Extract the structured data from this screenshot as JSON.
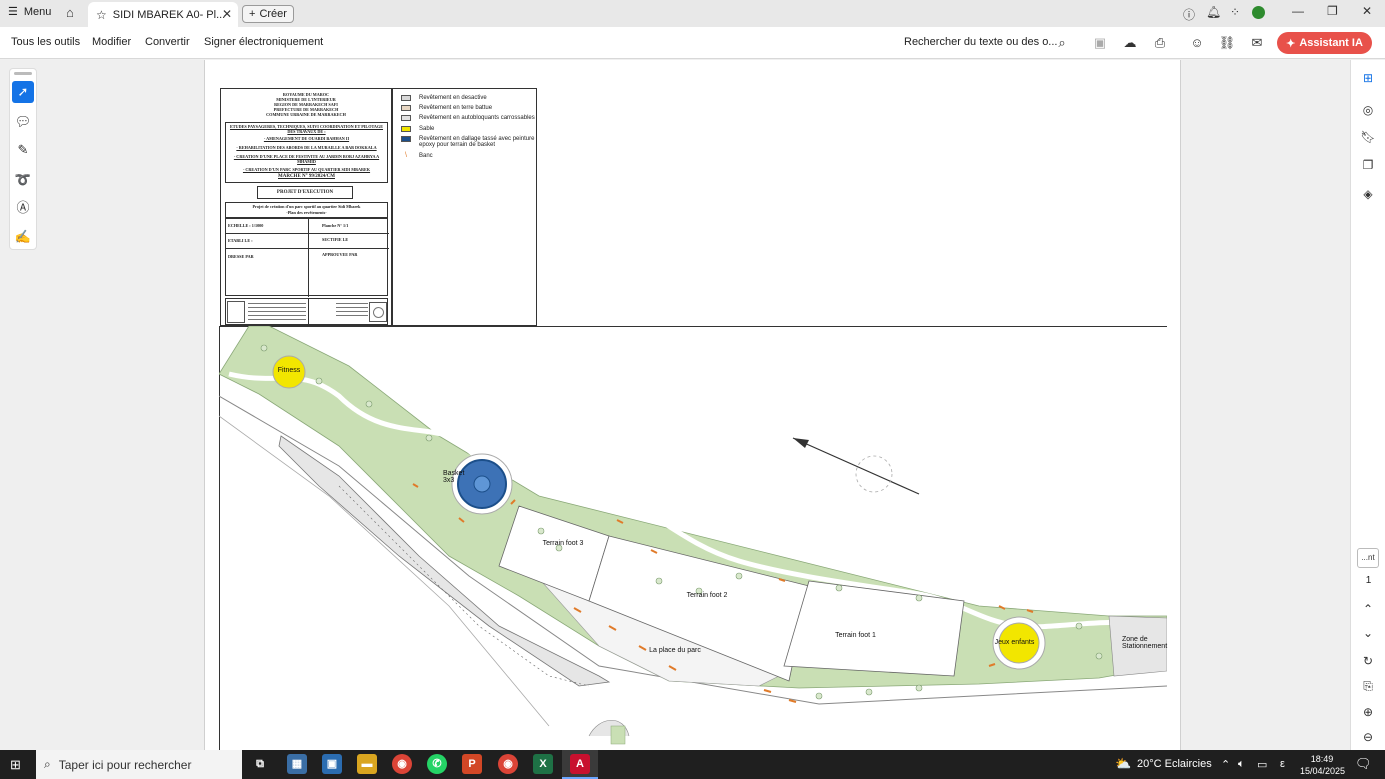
{
  "window": {
    "menu_label": "Menu",
    "tab_title": "SIDI MBAREK A0- Pl...",
    "tab_close": "✕",
    "create_label": "Créer",
    "controls": [
      "—",
      "❐",
      "✕"
    ]
  },
  "toolbar": {
    "all_tools": "Tous les outils",
    "edit": "Modifier",
    "convert": "Convertir",
    "sign": "Signer électroniquement",
    "search_text": "Rechercher du texte ou des o...",
    "assistant": "Assistant IA"
  },
  "rightrail": {
    "page_box": "...nt",
    "page_number": "1"
  },
  "plan": {
    "cartouche": {
      "header": [
        "ROYAUME DU MAROC",
        "MINISTERE DE L'INTERIEUR",
        "REGION DE MARRAKECH SAFI",
        "PREFECTURE DE MARRAKECH",
        "COMMUNE URBAINE DE MARRAKECH"
      ],
      "study_title": "ETUDES PAYSAGERES, TECHNIQUES, SUIVI COORDINATION ET PILOTAGE DES TRAVAUX DE :",
      "items": [
        "- AMENAGEMENT DE OUARDI BAHHAN II",
        "- REHABILITATION DES ABORDS DE LA MURAILLE A BAB DOKKALA",
        "- CREATION D'UNE PLACE DE FESTIVITE AU JARDIN BORJ AZAHRYA A MHAMID",
        "- CREATION D'UN PARC SPORTIF AU QUARTIER SIDI MBAREK"
      ],
      "marche": "MARCHE N° 99/2024/CM",
      "phase": "PROJET D'EXECUTION",
      "project_line1": "Projet de création d'un parc sportif au quartier Sidi Mbarek",
      "project_line2": "-Plan des revêtements-",
      "scale": "ECHELLE : 1/1000",
      "sheet": "Planche N° 1/1",
      "established": "ETABLI LE :",
      "revision": "SECTIFIE LE",
      "drawn_by": "DRESSE PAR",
      "approved_by": "APPROUVEE PAR"
    },
    "legend": [
      {
        "label": "Revêtement en desactive",
        "color": "#d9d9d9"
      },
      {
        "label": "Revêtement en terre battue",
        "color": "#e8d7c3"
      },
      {
        "label": "Revêtement en autobloquants carrossables",
        "color": "#e2e2e2"
      },
      {
        "label": "Sable",
        "color": "#f2e600"
      },
      {
        "label": "Revêtement en dallage tassé avec peinture epoxy pour terrain de basket",
        "color": "#1c4f8a"
      },
      {
        "label": "Banc",
        "color": "#e07b2a"
      }
    ],
    "labels": {
      "fitness": "Fitness",
      "basket": "Basket 3x3",
      "terrain3": "Terrain foot 3",
      "terrain2": "Terrain foot 2",
      "terrain1": "Terrain foot 1",
      "place": "La place du parc",
      "jeux": "Jeux enfants",
      "zone": "Zone de Stationnement"
    }
  },
  "taskbar": {
    "search_placeholder": "Taper ici pour rechercher",
    "weather": "20°C Eclaircies",
    "time": "18:49",
    "date": "15/04/2025"
  }
}
